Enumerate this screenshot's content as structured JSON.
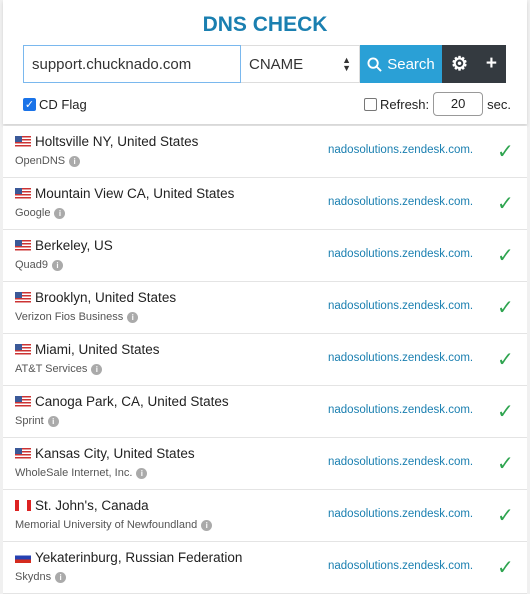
{
  "title": "DNS CHECK",
  "search": {
    "domain": "support.chucknado.com",
    "record_type": "CNAME",
    "search_label": "Search"
  },
  "options": {
    "cd_flag_label": "CD Flag",
    "cd_flag_checked": true,
    "refresh_label": "Refresh:",
    "refresh_checked": false,
    "refresh_value": "20",
    "refresh_unit": "sec."
  },
  "colors": {
    "accent": "#1a7fb0",
    "search_button": "#2aa0d6",
    "dark_button": "#343a40",
    "success": "#2ea44f"
  },
  "results": [
    {
      "location": "Holtsville NY, United States",
      "provider": "OpenDNS",
      "flag": "us",
      "result": "nadosolutions.zendesk.com.",
      "status": "ok"
    },
    {
      "location": "Mountain View CA, United States",
      "provider": "Google",
      "flag": "us",
      "result": "nadosolutions.zendesk.com.",
      "status": "ok"
    },
    {
      "location": "Berkeley, US",
      "provider": "Quad9",
      "flag": "us",
      "result": "nadosolutions.zendesk.com.",
      "status": "ok"
    },
    {
      "location": "Brooklyn, United States",
      "provider": "Verizon Fios Business",
      "flag": "us",
      "result": "nadosolutions.zendesk.com.",
      "status": "ok"
    },
    {
      "location": "Miami, United States",
      "provider": "AT&T Services",
      "flag": "us",
      "result": "nadosolutions.zendesk.com.",
      "status": "ok"
    },
    {
      "location": "Canoga Park, CA, United States",
      "provider": "Sprint",
      "flag": "us",
      "result": "nadosolutions.zendesk.com.",
      "status": "ok"
    },
    {
      "location": "Kansas City, United States",
      "provider": "WholeSale Internet, Inc.",
      "flag": "us",
      "result": "nadosolutions.zendesk.com.",
      "status": "ok"
    },
    {
      "location": "St. John's, Canada",
      "provider": "Memorial University of Newfoundland",
      "flag": "ca",
      "result": "nadosolutions.zendesk.com.",
      "status": "ok"
    },
    {
      "location": "Yekaterinburg, Russian Federation",
      "provider": "Skydns",
      "flag": "ru",
      "result": "nadosolutions.zendesk.com.",
      "status": "ok"
    }
  ]
}
